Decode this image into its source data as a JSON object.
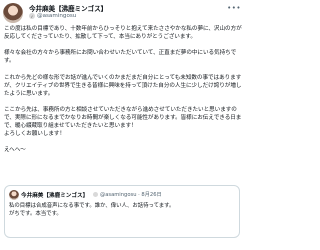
{
  "tweet": {
    "author_name": "今井麻美【沸鹿ミンゴス】",
    "author_handle": "@asamingosu",
    "more_icon": "more-icon",
    "text": "この度は私の目標であり、十数年前からひっそりと抱えて来たささやかな私の夢に、沢山の方が反応してくださっていたり、拡散して下って、本当にありがとうございます。\n\n様々な会社の方々から事務所にお問い合わせいただいていて、正直まだ夢の中にいる気持ちです。\n\nこれから先どの様な形でお話が進んでいくのかまだまだ自分にとっても未知数の事ではありますが、クリエイティブの世界で生きる皆様に興味を持って頂けた自分の人生に少しだけ誇りが増したように思います。\n\nここから先は、事務所の方と相談させていただきながら進めさせていただきたいと思いますので、実際に形になるまでかなりお時間が楽しくなる可能性があります。皆様にお伝えできる日まで、暖心綴蔵取り組ませていただきたいと思います！\nよろしくお願いします！\n\nえへへ〜"
  },
  "quoted": {
    "author_name": "今井麻美【沸鹿ミンゴス】",
    "author_handle": "@asamingosu · 8月26日",
    "text": "私の目標は合成音声になる事です。誰か、偉い人、お話待ってます。\nがちです。本当です。"
  }
}
